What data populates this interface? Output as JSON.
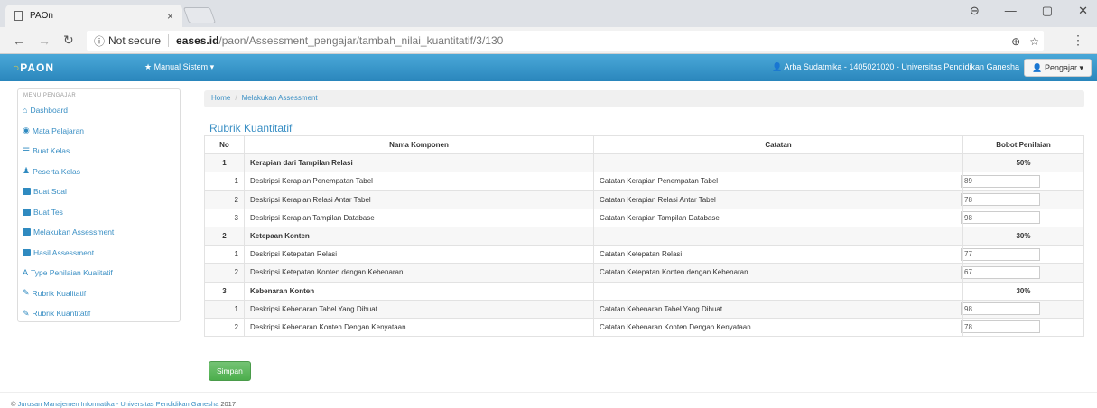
{
  "browser": {
    "tab_title": "PAOn",
    "tab_close": "×",
    "secure_label": "Not secure",
    "url_host": "eases.id",
    "url_path": "/paon/Assessment_pengajar/tambah_nilai_kuantitatif/3/130",
    "win_minimize": "—",
    "win_maximize": "▢",
    "win_close": "✕"
  },
  "navbar": {
    "brand": "PAON",
    "manual": "★ Manual Sistem ▾",
    "user": "Arba Sudatmika - 1405021020 - Universitas Pendidikan Ganesha",
    "role": "Pengajar ▾"
  },
  "sidebar": {
    "heading": "MENU PENGAJAR",
    "items": [
      {
        "label": "Dashboard",
        "icon": "home-icon"
      },
      {
        "label": "Mata Pelajaran",
        "icon": "eye-icon"
      },
      {
        "label": "Buat Kelas",
        "icon": "list-icon"
      },
      {
        "label": "Peserta Kelas",
        "icon": "user-icon"
      },
      {
        "label": "Buat Soal",
        "icon": "book-icon"
      },
      {
        "label": "Buat Tes",
        "icon": "book-icon"
      },
      {
        "label": "Melakukan Assessment",
        "icon": "folder-open-icon"
      },
      {
        "label": "Hasil Assessment",
        "icon": "folder-icon"
      },
      {
        "label": "Type Penilaian Kualitatif",
        "icon": "font-icon"
      },
      {
        "label": "Rubrik Kualitatif",
        "icon": "pencil-icon"
      },
      {
        "label": "Rubrik Kuantitatif",
        "icon": "pencil-icon"
      }
    ]
  },
  "breadcrumb": {
    "home": "Home",
    "current": "Melakukan Assessment"
  },
  "main": {
    "title": "Rubrik Kuantitatif",
    "headers": {
      "no": "No",
      "komponen": "Nama Komponen",
      "catatan": "Catatan",
      "bobot": "Bobot Penilaian"
    },
    "groups": [
      {
        "no": "1",
        "name": "Kerapian dari Tampilan Relasi",
        "bobot": "50%",
        "rows": [
          {
            "no": "1",
            "komponen": "Deskripsi Kerapian Penempatan Tabel",
            "catatan": "Catatan Kerapian Penempatan Tabel",
            "nilai": "89"
          },
          {
            "no": "2",
            "komponen": "Deskripsi Kerapian Relasi Antar Tabel",
            "catatan": "Catatan Kerapian Relasi Antar Tabel",
            "nilai": "78"
          },
          {
            "no": "3",
            "komponen": "Deskripsi Kerapian Tampilan Database",
            "catatan": "Catatan Kerapian Tampilan Database",
            "nilai": "98"
          }
        ]
      },
      {
        "no": "2",
        "name": "Ketepaan Konten",
        "bobot": "30%",
        "rows": [
          {
            "no": "1",
            "komponen": "Deskripsi Ketepatan Relasi",
            "catatan": "Catatan Ketepatan Relasi",
            "nilai": "77"
          },
          {
            "no": "2",
            "komponen": "Deskripsi Ketepatan Konten dengan Kebenaran",
            "catatan": "Catatan Ketepatan Konten dengan Kebenaran",
            "nilai": "67"
          }
        ]
      },
      {
        "no": "3",
        "name": "Kebenaran Konten",
        "bobot": "30%",
        "rows": [
          {
            "no": "1",
            "komponen": "Deskripsi Kebenaran Tabel Yang Dibuat",
            "catatan": "Catatan Kebenaran Tabel Yang Dibuat",
            "nilai": "98"
          },
          {
            "no": "2",
            "komponen": "Deskripsi Kebenaran Konten Dengan Kenyataan",
            "catatan": "Catatan Kebenaran Konten Dengan Kenyataan",
            "nilai": "78"
          }
        ]
      }
    ],
    "save_button": "Simpan"
  },
  "footer": {
    "prefix": "© ",
    "link": "Jurusan Manajemen Informatika - Universitas Pendidikan Ganesha",
    "year": " 2017"
  }
}
